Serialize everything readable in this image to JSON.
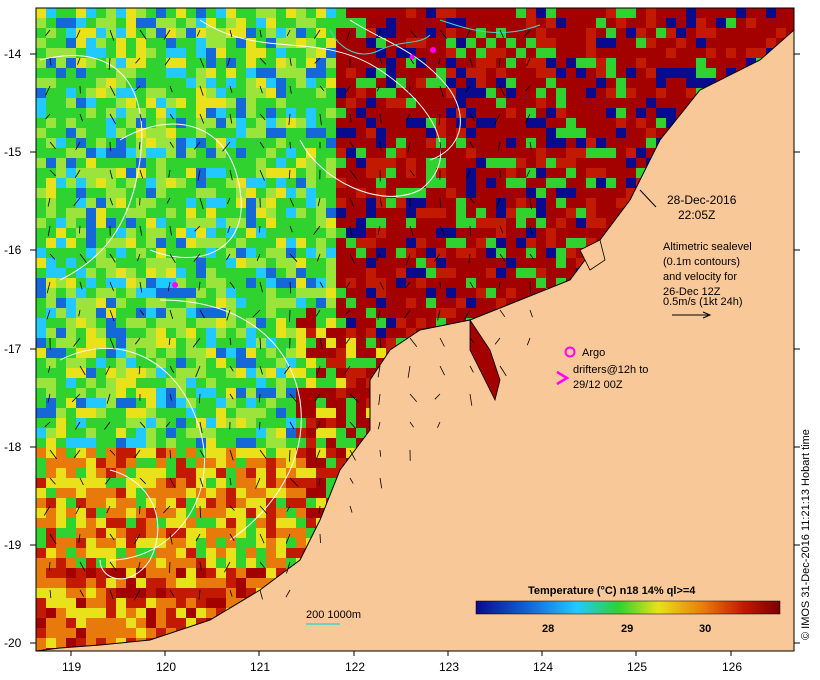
{
  "map": {
    "x_ticks": [
      "119",
      "120",
      "121",
      "122",
      "123",
      "124",
      "125",
      "126"
    ],
    "y_ticks": [
      "-14",
      "-15",
      "-16",
      "-17",
      "-18",
      "-19",
      "-20"
    ],
    "timestamp_date": "28-Dec-2016",
    "timestamp_time": "22:05Z",
    "altimetry_lines": [
      "Altimetric sealevel",
      "(0.1m contours)",
      "and velocity for",
      "26-Dec 12Z",
      "0.5m/s (1kt 24h)"
    ],
    "argo_label": "Argo",
    "drifter_line1": "drifters@12h to",
    "drifter_line2": "29/12 00Z",
    "depth_label": "200  1000m",
    "colorbar_title": "Temperature (°C) n18 14% ql>=4",
    "colorbar_ticks": [
      "28",
      "29",
      "30"
    ],
    "credit": "© IMOS 31-Dec-2016 11:21:13 Hobart time"
  },
  "colors": {
    "land": "#f9c899",
    "warm_dark": "#a30000",
    "warm": "#c21a00",
    "orange": "#e87a0c",
    "yellow": "#e9e11a",
    "green": "#2fd22f",
    "lightgreen": "#9be43c",
    "cyan": "#22c9ff",
    "blue": "#1468d8",
    "navy": "#0a0a8c",
    "magenta": "#ff00ff",
    "contour": "#ffffff",
    "isobath": "#3fd8c8"
  }
}
